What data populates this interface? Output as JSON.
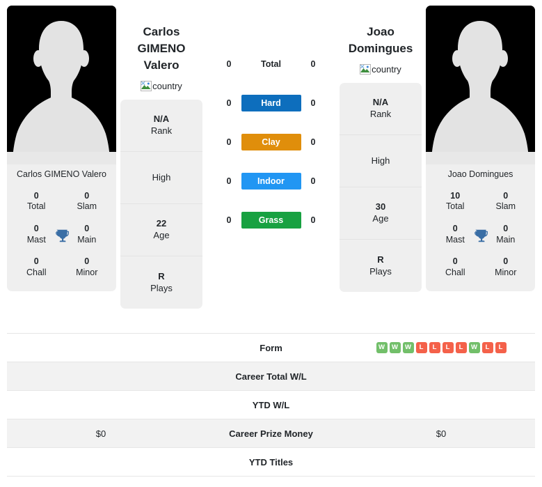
{
  "players": {
    "left": {
      "name": "Carlos GIMENO Valero",
      "name_display": "Carlos GIMENO\nValero",
      "card_name": "Carlos GIMENO Valero",
      "country_alt": "country",
      "titles": [
        {
          "value": "0",
          "label": "Total"
        },
        {
          "value": "0",
          "label": "Slam"
        },
        {
          "value": "0",
          "label": "Mast"
        },
        {
          "value": "0",
          "label": "Main"
        },
        {
          "value": "0",
          "label": "Chall"
        },
        {
          "value": "0",
          "label": "Minor"
        }
      ],
      "info": [
        {
          "value": "N/A",
          "label": "Rank"
        },
        {
          "value": "",
          "label": "High"
        },
        {
          "value": "22",
          "label": "Age"
        },
        {
          "value": "R",
          "label": "Plays"
        }
      ],
      "h2h": {
        "total": "0",
        "hard": "0",
        "clay": "0",
        "indoor": "0",
        "grass": "0"
      }
    },
    "right": {
      "name": "Joao Domingues",
      "name_display": "Joao\nDomingues",
      "card_name": "Joao Domingues",
      "country_alt": "country",
      "titles": [
        {
          "value": "10",
          "label": "Total"
        },
        {
          "value": "0",
          "label": "Slam"
        },
        {
          "value": "0",
          "label": "Mast"
        },
        {
          "value": "0",
          "label": "Main"
        },
        {
          "value": "0",
          "label": "Chall"
        },
        {
          "value": "0",
          "label": "Minor"
        }
      ],
      "info": [
        {
          "value": "N/A",
          "label": "Rank"
        },
        {
          "value": "",
          "label": "High"
        },
        {
          "value": "30",
          "label": "Age"
        },
        {
          "value": "R",
          "label": "Plays"
        }
      ],
      "h2h": {
        "total": "0",
        "hard": "0",
        "clay": "0",
        "indoor": "0",
        "grass": "0"
      }
    }
  },
  "surfaces": {
    "total_label": "Total",
    "rows": [
      {
        "key": "total",
        "label": "Total",
        "color": ""
      },
      {
        "key": "hard",
        "label": "Hard",
        "color": "#0d6ebd"
      },
      {
        "key": "clay",
        "label": "Clay",
        "color": "#e08e0b"
      },
      {
        "key": "indoor",
        "label": "Indoor",
        "color": "#2196f3"
      },
      {
        "key": "grass",
        "label": "Grass",
        "color": "#18a141"
      }
    ]
  },
  "stats_table": {
    "rows": [
      {
        "label": "Form",
        "left_value": "",
        "right_value": "",
        "left_form": [],
        "right_form": [
          "W",
          "W",
          "W",
          "L",
          "L",
          "L",
          "L",
          "W",
          "L",
          "L"
        ],
        "shaded": false
      },
      {
        "label": "Career Total W/L",
        "left_value": "",
        "right_value": "",
        "shaded": true
      },
      {
        "label": "YTD W/L",
        "left_value": "",
        "right_value": "",
        "shaded": false
      },
      {
        "label": "Career Prize Money",
        "left_value": "$0",
        "right_value": "$0",
        "shaded": true
      },
      {
        "label": "YTD Titles",
        "left_value": "",
        "right_value": "",
        "shaded": false
      }
    ]
  },
  "colors": {
    "hard": "#0d6ebd",
    "clay": "#e08e0b",
    "indoor": "#2196f3",
    "grass": "#18a141",
    "win_badge": "#72bf6a",
    "loss_badge": "#f4614a",
    "trophy": "#3a6ea5",
    "card_bg": "#efefef",
    "row_shade": "#f2f2f2"
  },
  "icons": {
    "trophy": "trophy-icon",
    "broken_image": "broken-image-icon"
  }
}
